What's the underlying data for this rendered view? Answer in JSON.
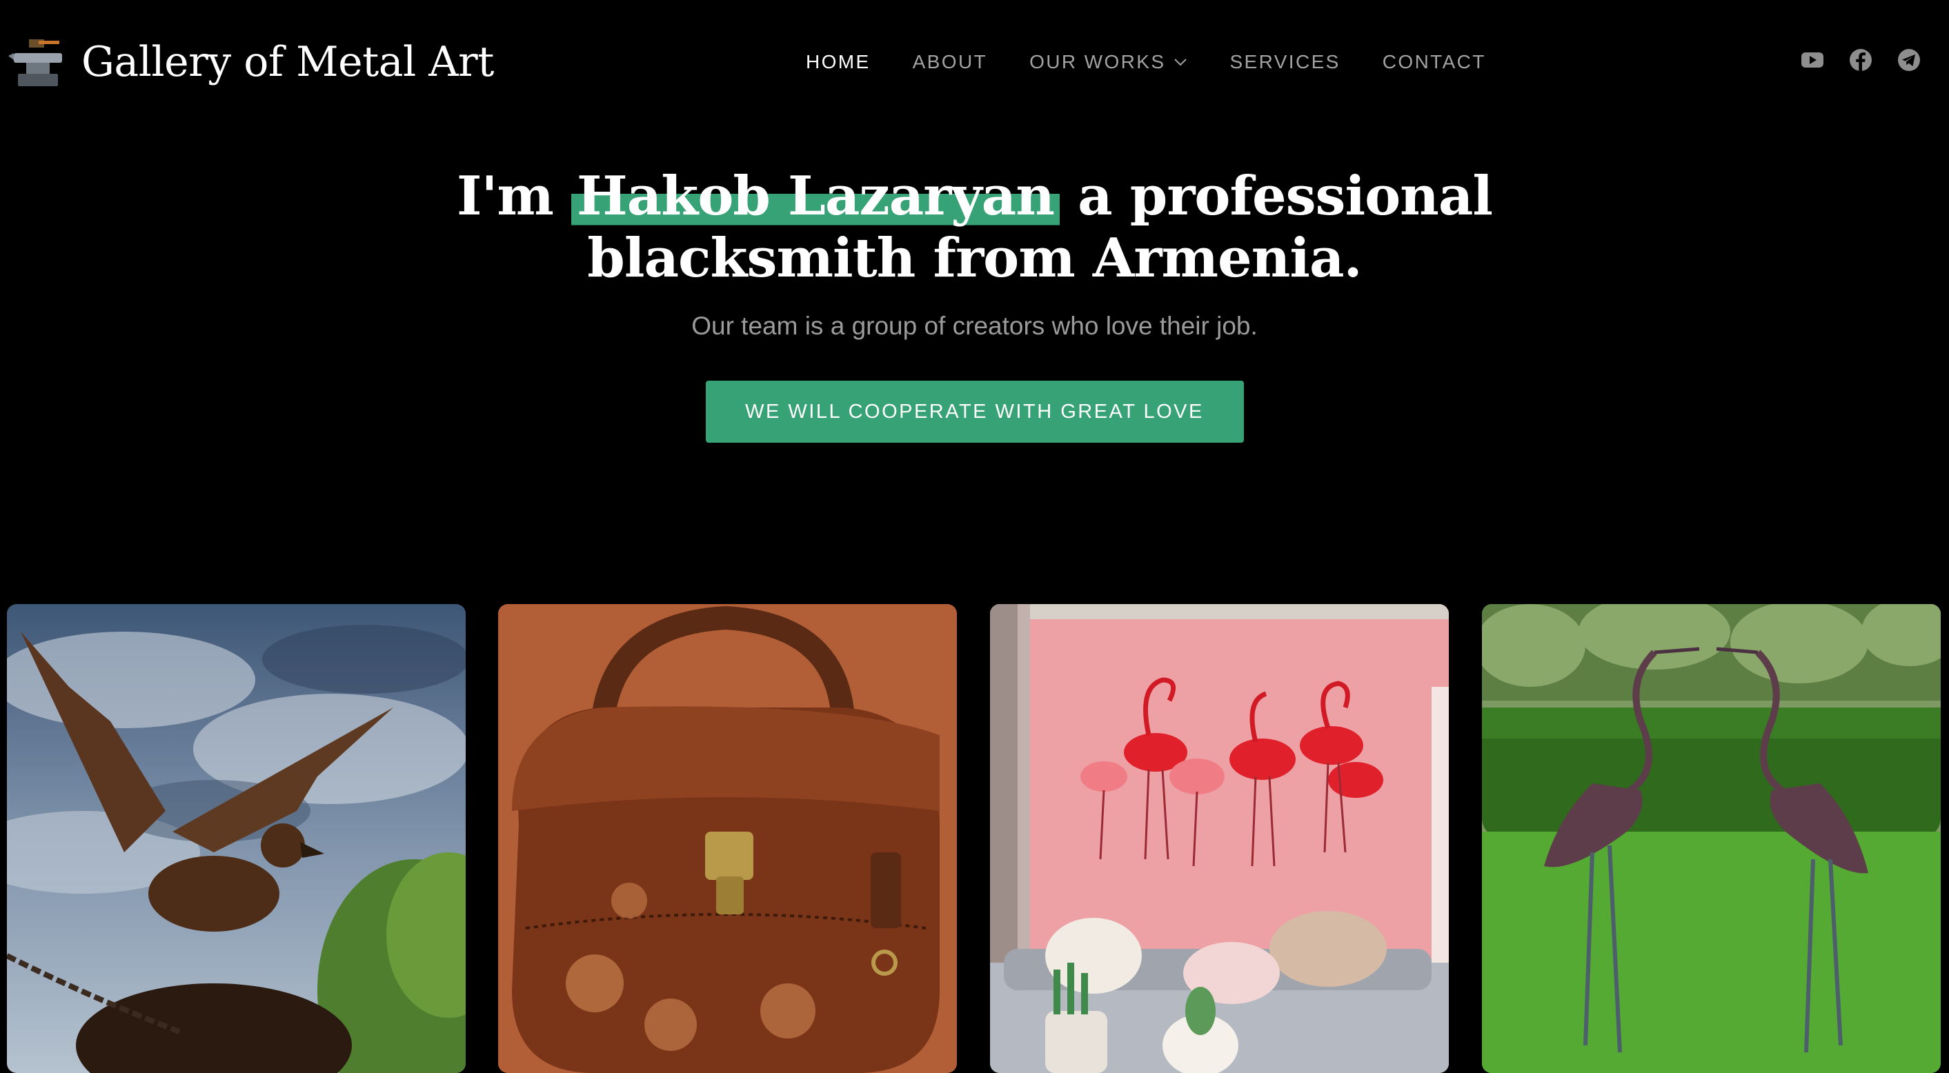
{
  "brand": {
    "name": "Gallery of Metal Art",
    "logo_icon": "anvil-icon"
  },
  "nav": [
    {
      "label": "HOME",
      "active": true
    },
    {
      "label": "ABOUT"
    },
    {
      "label": "OUR WORKS",
      "has_dropdown": true
    },
    {
      "label": "SERVICES"
    },
    {
      "label": "CONTACT"
    }
  ],
  "social": [
    "youtube-icon",
    "facebook-icon",
    "telegram-icon"
  ],
  "hero": {
    "title_prefix": "I'm",
    "title_highlight": "Hakob Lazaryan",
    "title_suffix": "a professional",
    "title_line2": "blacksmith from Armenia.",
    "subtitle": "Our team is a group of creators who love their job.",
    "cta_label": "WE WILL COOPERATE WITH GREAT LOVE"
  },
  "gallery": [
    {
      "subject": "eagle-sculpture"
    },
    {
      "subject": "leather-handbag"
    },
    {
      "subject": "flamingo-wall-art"
    },
    {
      "subject": "heron-garden-sculptures"
    }
  ],
  "colors": {
    "background": "#000000",
    "accent": "#36a275",
    "nav_text": "#a3a3a3",
    "nav_active": "#ffffff",
    "subtitle": "#9b9b9b"
  }
}
